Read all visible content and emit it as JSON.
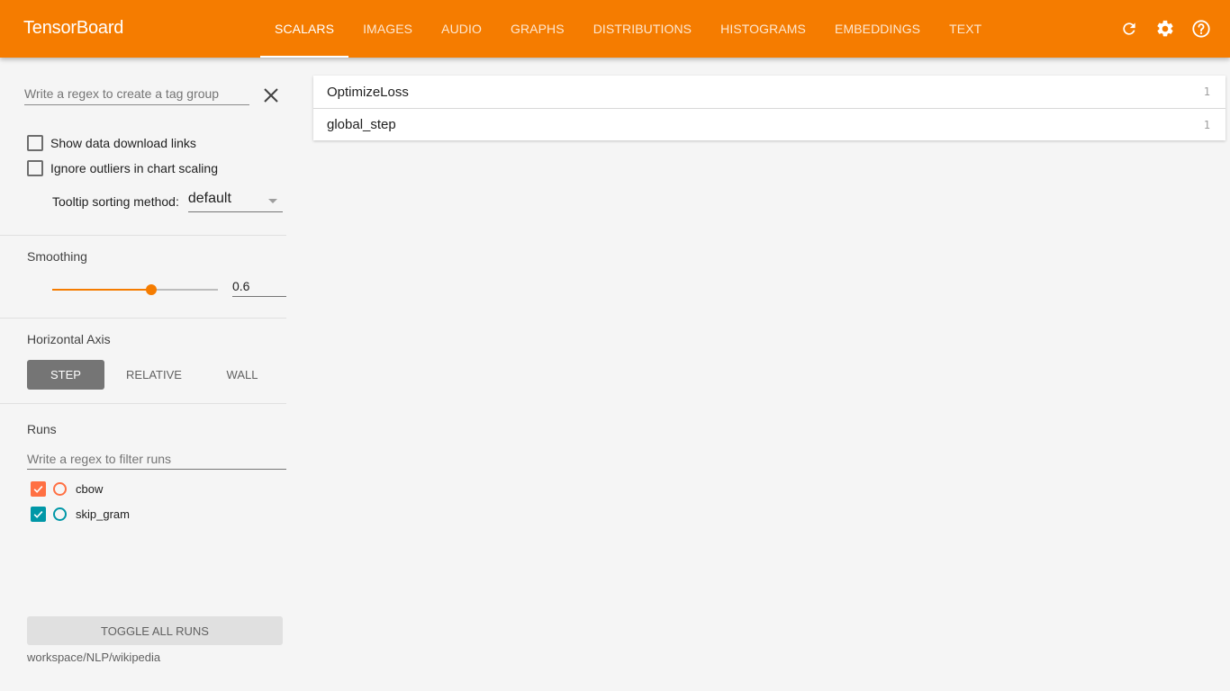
{
  "header": {
    "title": "TensorBoard",
    "tabs": [
      {
        "label": "SCALARS",
        "active": true
      },
      {
        "label": "IMAGES"
      },
      {
        "label": "AUDIO"
      },
      {
        "label": "GRAPHS"
      },
      {
        "label": "DISTRIBUTIONS"
      },
      {
        "label": "HISTOGRAMS"
      },
      {
        "label": "EMBEDDINGS"
      },
      {
        "label": "TEXT"
      }
    ],
    "icons": [
      "refresh-icon",
      "settings-gear-icon",
      "help-icon"
    ],
    "accent_color": "#f57c00"
  },
  "sidebar": {
    "tag_group_placeholder": "Write a regex to create a tag group",
    "show_download_links": {
      "label": "Show data download links",
      "checked": false
    },
    "ignore_outliers": {
      "label": "Ignore outliers in chart scaling",
      "checked": false
    },
    "tooltip_sorting": {
      "label": "Tooltip sorting method:",
      "value": "default"
    },
    "smoothing": {
      "title": "Smoothing",
      "value": "0.6",
      "fraction": 0.6
    },
    "horizontal_axis": {
      "title": "Horizontal Axis",
      "options": [
        {
          "label": "STEP",
          "active": true
        },
        {
          "label": "RELATIVE"
        },
        {
          "label": "WALL"
        }
      ]
    },
    "runs": {
      "title": "Runs",
      "filter_placeholder": "Write a regex to filter runs",
      "items": [
        {
          "name": "cbow",
          "checked": true,
          "color": "#ff7043"
        },
        {
          "name": "skip_gram",
          "checked": true,
          "color": "#0097a7"
        }
      ],
      "toggle_all_label": "TOGGLE ALL RUNS",
      "logdir": "workspace/NLP/wikipedia"
    }
  },
  "main": {
    "tags": [
      {
        "name": "OptimizeLoss",
        "count": "1"
      },
      {
        "name": "global_step",
        "count": "1"
      }
    ]
  }
}
